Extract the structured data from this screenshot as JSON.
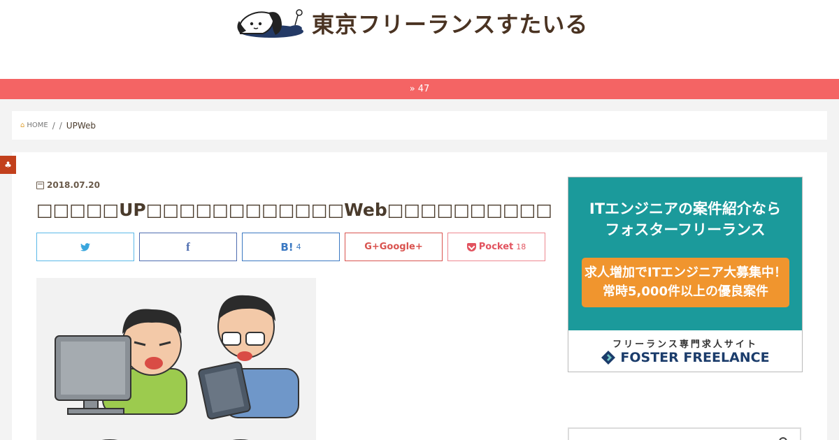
{
  "site": {
    "logo_text": "東京フリーランスすたいる"
  },
  "info_bar": {
    "chevron": "»",
    "text": "47"
  },
  "breadcrumb": {
    "home_icon": "house-icon",
    "home_label": "HOME",
    "separator1": "/",
    "separator2": "/",
    "current": "UPWeb"
  },
  "article": {
    "date": "2018.07.20",
    "title": "□□□□□UP□□□□□□□□□□□□Web□□□□□□□□□□□□□",
    "share": {
      "twitter": {
        "icon": "twitter-icon",
        "label": ""
      },
      "facebook": {
        "icon": "facebook-icon",
        "label": "f"
      },
      "hatena": {
        "icon": "hatena-bookmark-icon",
        "label": "B!",
        "count": "4"
      },
      "google": {
        "icon": "google-plus-icon",
        "label": "G+Google+"
      },
      "pocket": {
        "icon": "pocket-icon",
        "label": "Pocket",
        "count": "18"
      }
    }
  },
  "ad": {
    "headline_line1": "ITエンジニアの案件紹介なら",
    "headline_line2": "フォスターフリーランス",
    "cta_line1": "求人増加でITエンジニア大募集中！",
    "cta_line2": "常時5,000件以上の優良案件",
    "sub": "フリーランス専門求人サイト",
    "brand": "FOSTER FREELANCE",
    "colors": {
      "teal": "#1b9a9b",
      "orange": "#f0952e",
      "navy": "#1b3c6b"
    }
  },
  "colors": {
    "accent_red": "#f46464",
    "corner_tag": "#c2401c",
    "text_brown": "#4a3b2c"
  }
}
